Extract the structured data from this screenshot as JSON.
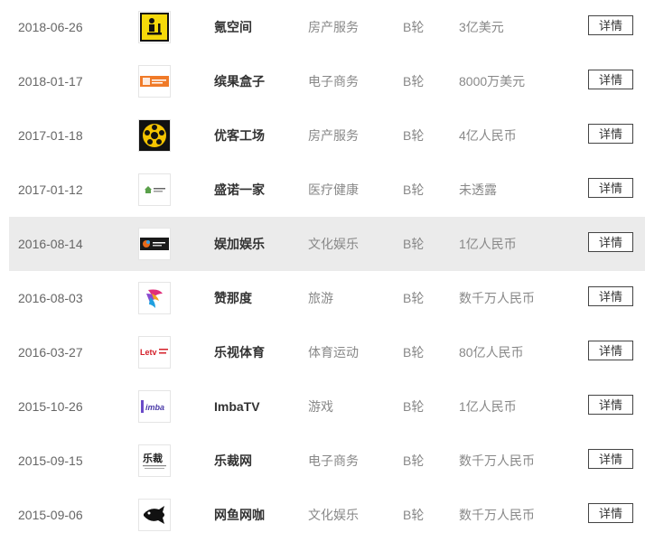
{
  "investments": [
    {
      "date": "2018-06-26",
      "logo_icon": "yellow-person-desk-logo-icon",
      "name": "氪空间",
      "industry": "房产服务",
      "round": "B轮",
      "amount": "3亿美元",
      "detail_label": "详情"
    },
    {
      "date": "2018-01-17",
      "logo_icon": "orange-box-logo-icon",
      "name": "缤果盒子",
      "industry": "电子商务",
      "round": "B轮",
      "amount": "8000万美元",
      "detail_label": "详情"
    },
    {
      "date": "2017-01-18",
      "logo_icon": "yellow-black-hex-logo-icon",
      "name": "优客工场",
      "industry": "房产服务",
      "round": "B轮",
      "amount": "4亿人民币",
      "detail_label": "详情"
    },
    {
      "date": "2017-01-12",
      "logo_icon": "green-house-logo-icon",
      "name": "盛诺一家",
      "industry": "医疗健康",
      "round": "B轮",
      "amount": "未透露",
      "detail_label": "详情"
    },
    {
      "date": "2016-08-14",
      "logo_icon": "dark-entertainment-logo-icon",
      "name": "娱加娱乐",
      "industry": "文化娱乐",
      "round": "B轮",
      "amount": "1亿人民币",
      "detail_label": "详情"
    },
    {
      "date": "2016-08-03",
      "logo_icon": "colorful-bird-logo-icon",
      "name": "赞那度",
      "industry": "旅游",
      "round": "B轮",
      "amount": "数千万人民币",
      "detail_label": "详情"
    },
    {
      "date": "2016-03-27",
      "logo_icon": "letv-sports-logo-icon",
      "name": "乐视体育",
      "industry": "体育运动",
      "round": "B轮",
      "amount": "80亿人民币",
      "detail_label": "详情"
    },
    {
      "date": "2015-10-26",
      "logo_icon": "imba-logo-icon",
      "name": "ImbaTV",
      "industry": "游戏",
      "round": "B轮",
      "amount": "1亿人民币",
      "detail_label": "详情"
    },
    {
      "date": "2015-09-15",
      "logo_icon": "lecai-logo-icon",
      "name": "乐裁网",
      "industry": "电子商务",
      "round": "B轮",
      "amount": "数千万人民币",
      "detail_label": "详情"
    },
    {
      "date": "2015-09-06",
      "logo_icon": "black-fish-logo-icon",
      "name": "网鱼网咖",
      "industry": "文化娱乐",
      "round": "B轮",
      "amount": "数千万人民币",
      "detail_label": "详情"
    }
  ],
  "logo_text": {
    "letv": "Letv",
    "imba": "imba",
    "lecai": "乐裁"
  },
  "highlight_row_index": 4,
  "colors": {
    "highlight_row": "#ebebeb",
    "date_text": "#666666",
    "name_text": "#333333",
    "meta_text": "#888888"
  }
}
